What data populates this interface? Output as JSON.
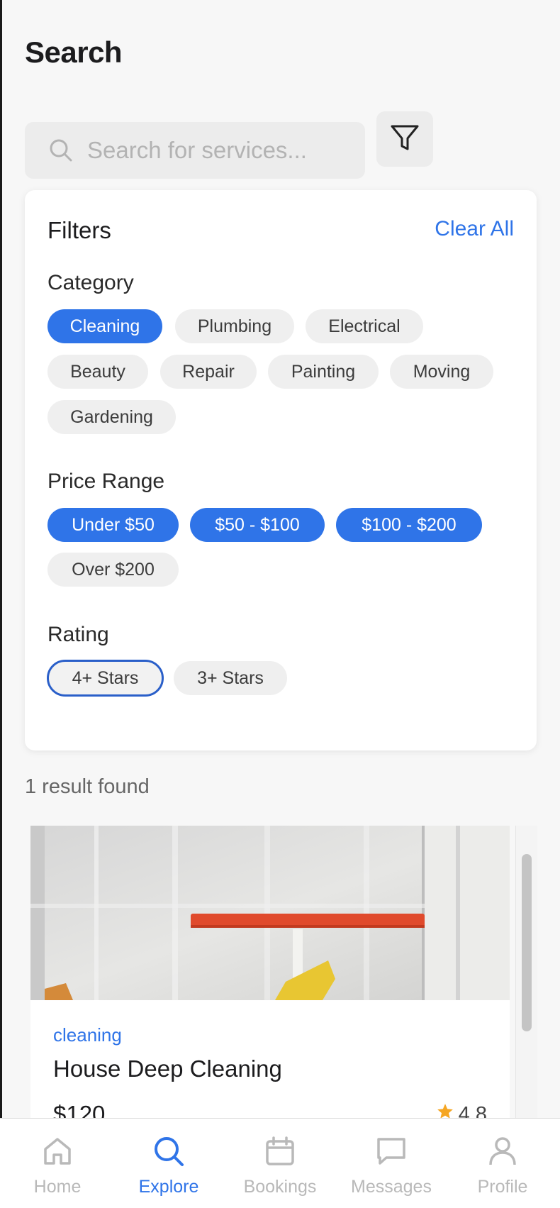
{
  "header": {
    "title": "Search"
  },
  "search": {
    "placeholder": "Search for services...",
    "value": ""
  },
  "filters": {
    "title": "Filters",
    "clear_label": "Clear All",
    "category": {
      "label": "Category",
      "options": [
        "Cleaning",
        "Plumbing",
        "Electrical",
        "Beauty",
        "Repair",
        "Painting",
        "Moving",
        "Gardening"
      ],
      "selected": [
        "Cleaning"
      ]
    },
    "price_range": {
      "label": "Price Range",
      "options": [
        "Under $50",
        "$50 - $100",
        "$100 - $200",
        "Over $200"
      ],
      "selected": [
        "Under $50",
        "$50 - $100",
        "$100 - $200"
      ]
    },
    "rating": {
      "label": "Rating",
      "options": [
        "4+ Stars",
        "3+ Stars"
      ],
      "focused": "4+ Stars"
    }
  },
  "results": {
    "count_text": "1 result found",
    "items": [
      {
        "category": "cleaning",
        "title": "House Deep Cleaning",
        "price": "$120",
        "rating": "4.8"
      }
    ]
  },
  "nav": {
    "items": [
      {
        "label": "Home",
        "icon": "home-icon",
        "active": false
      },
      {
        "label": "Explore",
        "icon": "search-icon",
        "active": true
      },
      {
        "label": "Bookings",
        "icon": "calendar-icon",
        "active": false
      },
      {
        "label": "Messages",
        "icon": "message-icon",
        "active": false
      },
      {
        "label": "Profile",
        "icon": "user-icon",
        "active": false
      }
    ]
  },
  "colors": {
    "accent": "#2f74e8",
    "star": "#f5a623",
    "inactive": "#b9b9b9"
  }
}
